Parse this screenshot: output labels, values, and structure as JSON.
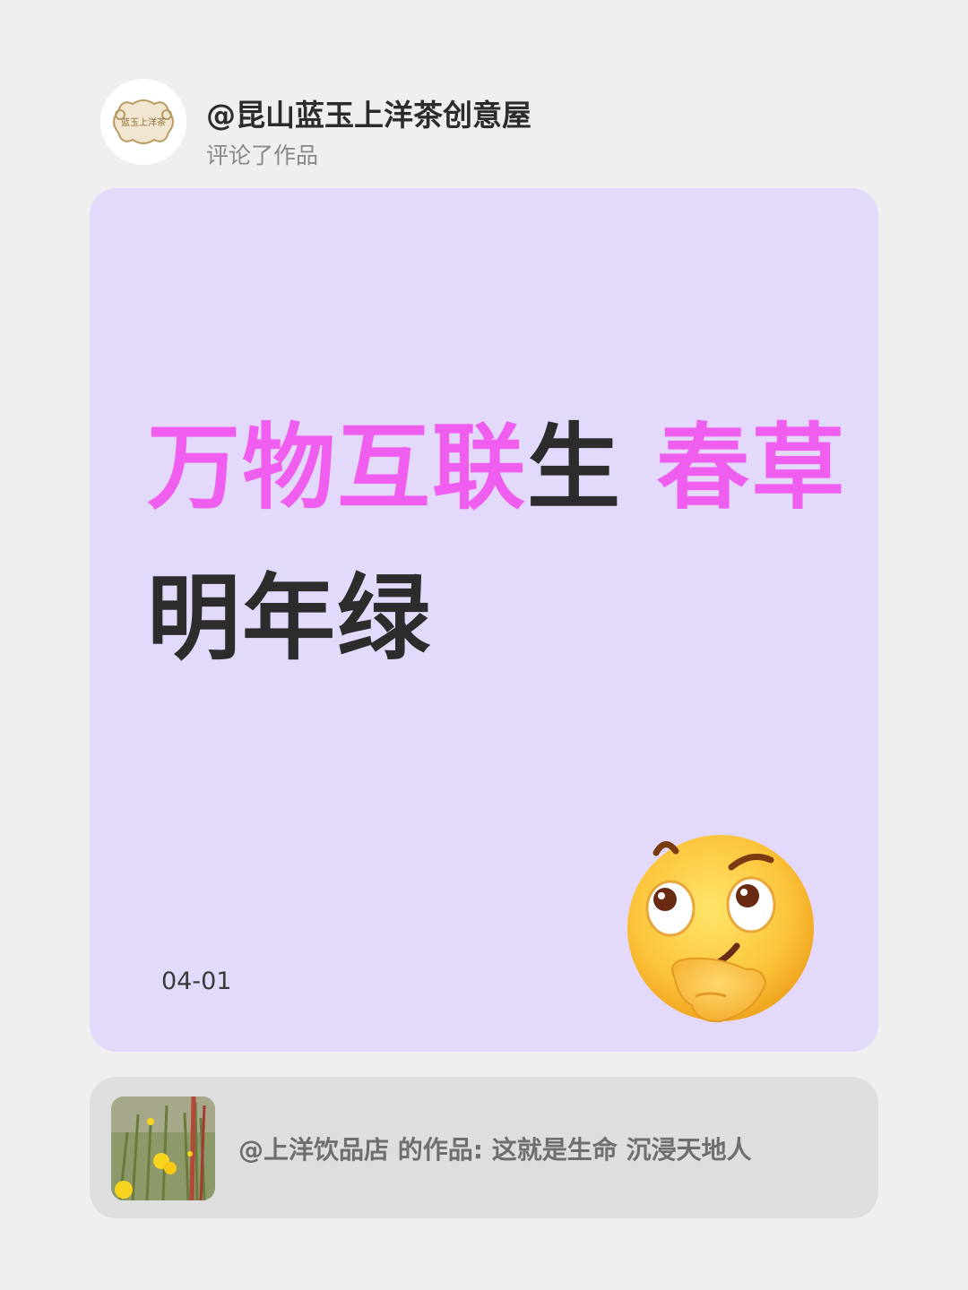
{
  "comment": {
    "username": "@昆山蓝玉上洋茶创意屋",
    "action": "评论了作品",
    "avatar_text": "蓝玉上洋茶",
    "quote_segments": [
      {
        "text": "万物互联",
        "color": "pink"
      },
      {
        "text": "生 ",
        "color": "dark"
      },
      {
        "text": "春草",
        "color": "pink"
      },
      {
        "text": "明年绿",
        "color": "dark"
      }
    ],
    "date": "04-01",
    "emoji": "thinking-face-icon"
  },
  "referenced_work": {
    "text": "@上洋饮品店 的作品: 这就是生命 沉浸天地人"
  },
  "colors": {
    "page_bg": "#efeff0",
    "card_bg": "#e3dafb",
    "accent_pink": "#f05ef0",
    "text_dark": "#2c2c2c",
    "ref_bg": "#dedede"
  }
}
